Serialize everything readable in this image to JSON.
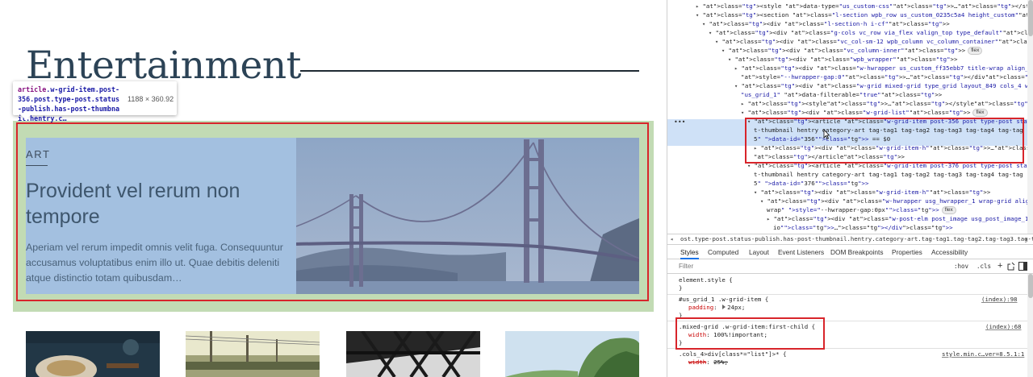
{
  "page": {
    "heading": "Entertainment",
    "tooltip": {
      "selector_tag": "article",
      "selector_classes": ".w-grid-item.post-356.post.type-post.status-publish.has-post-thumbnail.hentry.c…",
      "size": "1188 × 360.92"
    },
    "card": {
      "category": "ART",
      "title": "Provident vel rerum non tempore",
      "excerpt": "Aperiam vel rerum impedit omnis velit fuga. Consequuntur accusamus voluptatibus enim illo ut. Quae debitis deleniti atque distinctio totam quibusdam…",
      "image_icon": "golden-gate-bridge-image"
    },
    "thumbnails": [
      "food-photo",
      "railway-photo",
      "bridge-underside-photo",
      "trees-photo"
    ]
  },
  "devtools": {
    "dom_lines": [
      {
        "indent": 0,
        "arrow": "▸",
        "html": "<style data-type=\"us_custom-css\">…</style>"
      },
      {
        "indent": 0,
        "arrow": "▾",
        "html": "<section class=\"l-section wpb_row us_custom_0235c5a4 height_custom\">"
      },
      {
        "indent": 1,
        "arrow": "▾",
        "html": "<div class=\"l-section-h i-cf\">"
      },
      {
        "indent": 2,
        "arrow": "▾",
        "html": "<div class=\"g-cols vc_row via_flex valign_top type_default\">",
        "badge": "flex"
      },
      {
        "indent": 3,
        "arrow": "▾",
        "html": "<div class=\"vc_col-sm-12 wpb_column vc_column_container\">",
        "badge": "flex"
      },
      {
        "indent": 4,
        "arrow": "▾",
        "html": "<div class=\"vc_column-inner\">",
        "badge": "flex"
      },
      {
        "indent": 5,
        "arrow": "▾",
        "html": "<div class=\"wpb_wrapper\">"
      },
      {
        "indent": 6,
        "arrow": "▸",
        "html": "<div class=\"w-hwrapper us_custom_ff35ebb7 title-wrap align_none valign_top\""
      },
      {
        "indent": 6,
        "arrow": "",
        "html": "style=\"--hwrapper-gap:0\">…</div>",
        "badge": "flex"
      },
      {
        "indent": 6,
        "arrow": "▾",
        "html": "<div class=\"w-grid mixed-grid type_grid layout_849 cols_4 with_pagination\" id="
      },
      {
        "indent": 6,
        "arrow": "",
        "html": "\"us_grid_1\" data-filterable=\"true\">"
      },
      {
        "indent": 7,
        "arrow": "▸",
        "html": "<style>…</style>"
      },
      {
        "indent": 7,
        "arrow": "▾",
        "html": "<div class=\"w-grid-list\">",
        "badge": "flex"
      },
      {
        "indent": 8,
        "arrow": "▾",
        "html": "<article class=\"w-grid-item post-356 post type-post status-publish has-pos"
      },
      {
        "indent": 8,
        "arrow": "",
        "html": "t-thumbnail hentry category-art tag-tag1 tag-tag2 tag-tag3 tag-tag4 tag-tag"
      },
      {
        "indent": 8,
        "arrow": "",
        "html": "5\" data-id=\"356\"> == $0"
      },
      {
        "indent": 9,
        "arrow": "▸",
        "html": "<div class=\"w-grid-item-h\">…</div>"
      },
      {
        "indent": 8,
        "arrow": "",
        "html": "</article>"
      },
      {
        "indent": 8,
        "arrow": "▾",
        "html": "<article class=\"w-grid-item post-376 post type-post status-publish has-pos"
      },
      {
        "indent": 8,
        "arrow": "",
        "html": "t-thumbnail hentry category-art tag-tag1 tag-tag2 tag-tag3 tag-tag4 tag-tag"
      },
      {
        "indent": 8,
        "arrow": "",
        "html": "5\" data-id=\"376\">"
      },
      {
        "indent": 9,
        "arrow": "▾",
        "html": "<div class=\"w-grid-item-h\">"
      },
      {
        "indent": 10,
        "arrow": "▾",
        "html": "<div class=\"w-hwrapper usg_hwrapper_1 wrap-grid align_none valign_top"
      },
      {
        "indent": 10,
        "arrow": "",
        "html": "wrap\" style=\"--hwrapper-gap:0px\">",
        "badge": "flex"
      },
      {
        "indent": 11,
        "arrow": "▸",
        "html": "<div class=\"w-post-elm post_image usg_post_image_1 has_width has_rat"
      },
      {
        "indent": 11,
        "arrow": "",
        "html": "io\">…</div>"
      }
    ],
    "breadcrumb": "ost.type-post.status-publish.has-post-thumbnail.hentry.category-art.tag-tag1.tag-tag2.tag-tag3.tag-tag4.tag-tag5",
    "tabs": [
      "Styles",
      "Computed",
      "Layout",
      "Event Listeners",
      "DOM Breakpoints",
      "Properties",
      "Accessibility"
    ],
    "active_tab": "Styles",
    "filter_placeholder": "Filter",
    "hov_label": ":hov",
    "cls_label": ".cls",
    "rules": [
      {
        "selector": "element.style {",
        "props": [],
        "close": "}",
        "source": ""
      },
      {
        "selector": "#us_grid_1 .w-grid-item {",
        "props": [
          {
            "name": "padding",
            "value": "24px;",
            "triangle": true
          }
        ],
        "close": "}",
        "source": "(index):98"
      },
      {
        "selector": ".mixed-grid .w-grid-item:first-child {",
        "props": [
          {
            "name": "width",
            "value": "100%!important;"
          }
        ],
        "close": "}",
        "source": "(index):68"
      },
      {
        "selector": ".cols_4>div[class*=\"list\"]>* {",
        "props": [
          {
            "name": "width",
            "value": "25%;",
            "struck": true
          }
        ],
        "close": "",
        "source": "style.min.c…ver=8.5.1:1"
      }
    ]
  },
  "colors": {
    "highlight_green": "#c2dbb4",
    "highlight_blue": "#a3c0e0",
    "annotation_red": "#d8252b",
    "heading_navy": "#2c4356",
    "devtools_selected": "#cfe1f7"
  }
}
